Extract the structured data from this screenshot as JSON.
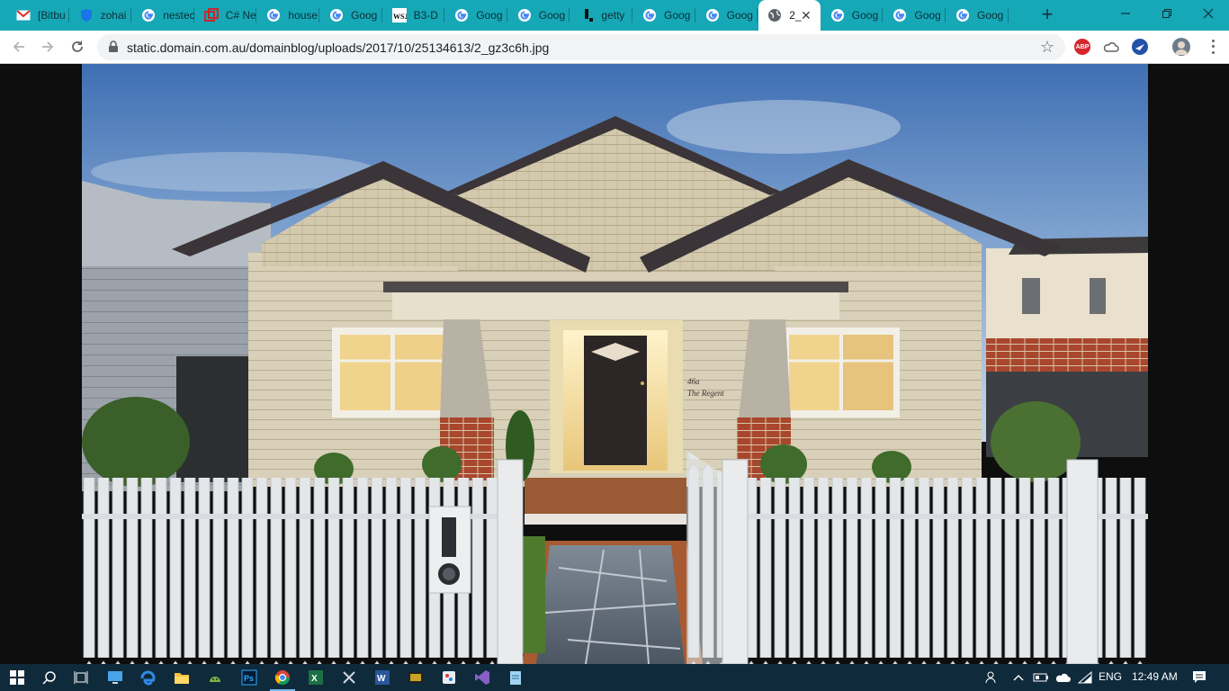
{
  "browser": {
    "tabs": [
      {
        "title": "[Bitbu",
        "icon": "gmail-icon"
      },
      {
        "title": "zohai",
        "icon": "shield-ext-icon"
      },
      {
        "title": "nestec",
        "icon": "google-icon"
      },
      {
        "title": "C# Ne",
        "icon": "stack-icon"
      },
      {
        "title": "house",
        "icon": "google-icon"
      },
      {
        "title": "Goog",
        "icon": "google-icon"
      },
      {
        "title": "B3-D",
        "icon": "wsj-icon"
      },
      {
        "title": "Goog",
        "icon": "google-icon"
      },
      {
        "title": "Goog",
        "icon": "google-icon"
      },
      {
        "title": "getty",
        "icon": "getty-icon"
      },
      {
        "title": "Goog",
        "icon": "google-icon"
      },
      {
        "title": "Goog",
        "icon": "google-icon"
      },
      {
        "title": "2_",
        "icon": "globe-icon",
        "active": true
      },
      {
        "title": "Goog",
        "icon": "google-icon"
      },
      {
        "title": "Goog",
        "icon": "google-icon"
      },
      {
        "title": "Goog",
        "icon": "google-icon"
      }
    ],
    "new_tab_label": "+",
    "url": "static.domain.com.au/domainblog/uploads/2017/10/25134613/2_gz3c6h.jpg",
    "extensions": [
      "ABP"
    ]
  },
  "photo": {
    "sign_number": "46a",
    "sign_name": "The Regent"
  },
  "taskbar": {
    "language": "ENG",
    "time": "12:49 AM"
  },
  "colors": {
    "tabstrip": "#16a8b7",
    "taskbar": "#0f2a3b",
    "sky_top": "#3f6fb3",
    "weatherboard": "#d8d0b8",
    "roof": "#3b3438"
  }
}
